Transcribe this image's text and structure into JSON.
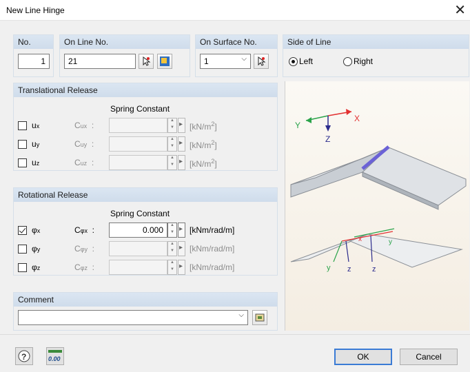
{
  "window": {
    "title": "New Line Hinge",
    "close_glyph": "✕"
  },
  "header": {
    "no_label": "No.",
    "no_value": "1",
    "online_label": "On Line No.",
    "online_value": "21",
    "onsurface_label": "On Surface No.",
    "onsurface_value": "1",
    "side_label": "Side of Line",
    "left_label": "Left",
    "right_label": "Right",
    "side_selected": "Left"
  },
  "translational": {
    "title": "Translational Release",
    "spring_header": "Spring Constant",
    "rows": [
      {
        "dof": "u",
        "sub": "x",
        "const": "C",
        "const_sub": "ux",
        "unit_base": "[kN/m",
        "unit_exp": "2",
        "unit_end": "]",
        "checked": false,
        "value": ""
      },
      {
        "dof": "u",
        "sub": "y",
        "const": "C",
        "const_sub": "uy",
        "unit_base": "[kN/m",
        "unit_exp": "2",
        "unit_end": "]",
        "checked": false,
        "value": ""
      },
      {
        "dof": "u",
        "sub": "z",
        "const": "C",
        "const_sub": "uz",
        "unit_base": "[kN/m",
        "unit_exp": "2",
        "unit_end": "]",
        "checked": false,
        "value": ""
      }
    ]
  },
  "rotational": {
    "title": "Rotational Release",
    "spring_header": "Spring Constant",
    "rows": [
      {
        "dof": "φ",
        "sub": "x",
        "const": "C",
        "const_sub": "φx",
        "unit": "[kNm/rad/m]",
        "checked": true,
        "value": "0.000"
      },
      {
        "dof": "φ",
        "sub": "y",
        "const": "C",
        "const_sub": "φy",
        "unit": "[kNm/rad/m]",
        "checked": false,
        "value": ""
      },
      {
        "dof": "φ",
        "sub": "z",
        "const": "C",
        "const_sub": "φz",
        "unit": "[kNm/rad/m]",
        "checked": false,
        "value": ""
      }
    ]
  },
  "comment": {
    "label": "Comment",
    "value": ""
  },
  "buttons": {
    "ok": "OK",
    "cancel": "Cancel",
    "units_icon": "0.00"
  },
  "preview_labels": {
    "X": "X",
    "Y": "Y",
    "Z": "Z",
    "x": "x",
    "y": "y",
    "z": "z"
  },
  "colors": {
    "accent": "#3a7bd5",
    "group_header": "#dbe6f2"
  }
}
